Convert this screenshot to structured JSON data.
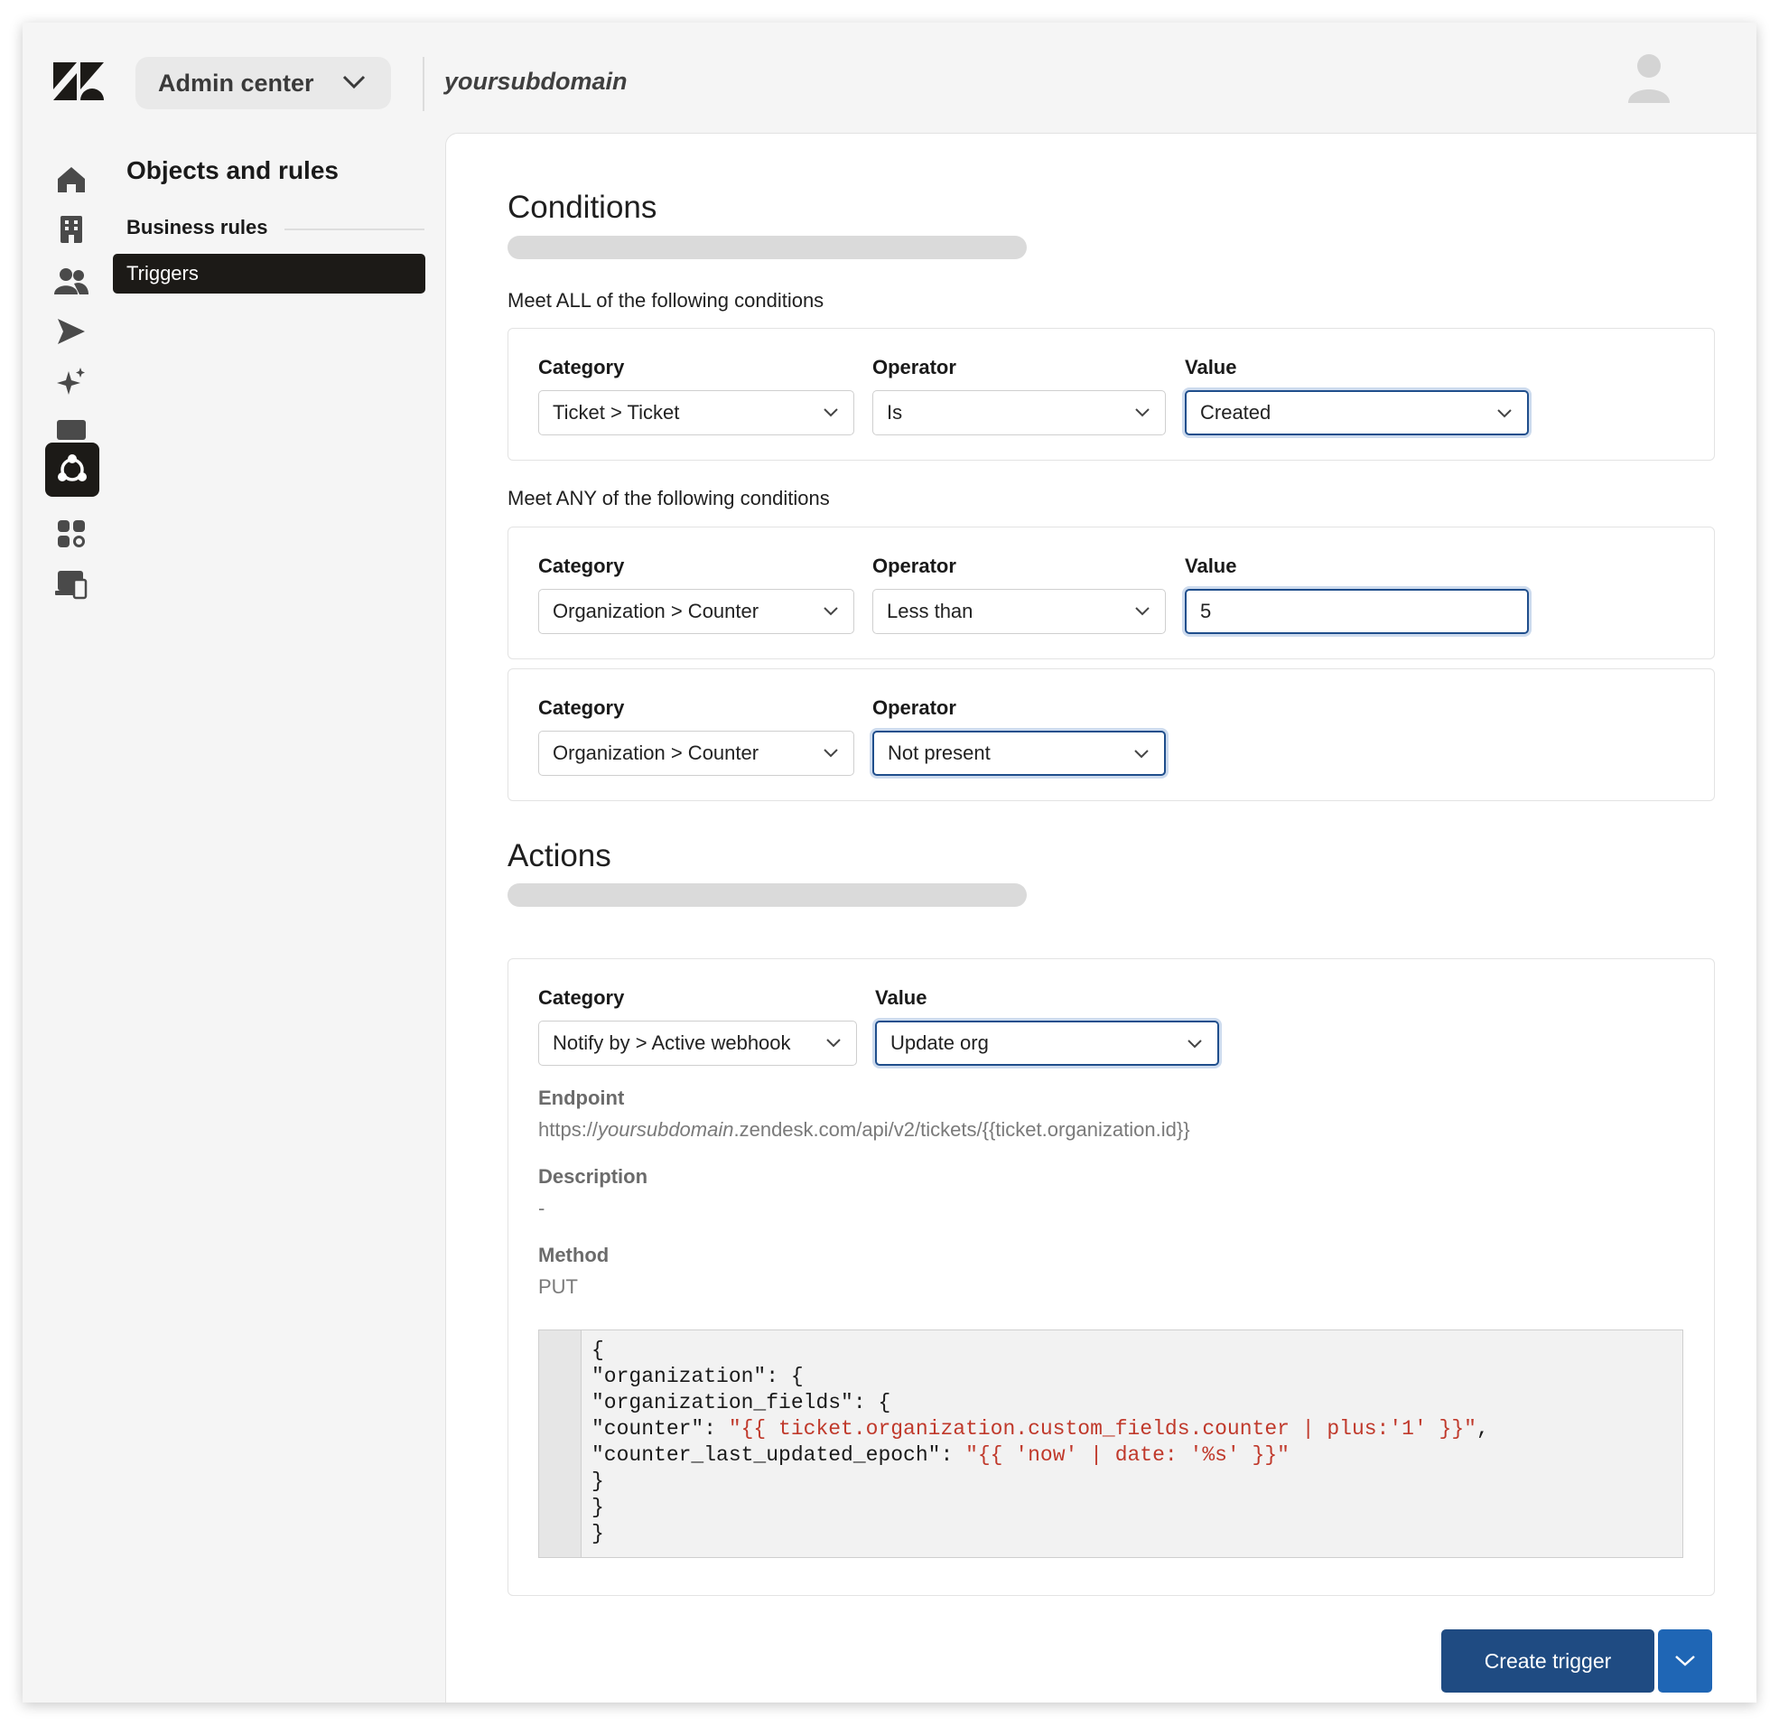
{
  "header": {
    "product_menu_label": "Admin center",
    "subdomain": "yoursubdomain"
  },
  "rail": {
    "icons": [
      "home-icon",
      "building-icon",
      "people-icon",
      "send-icon",
      "sparkle-icon",
      "workspace-icon",
      "objects-rules-icon",
      "apps-icon",
      "devices-icon"
    ],
    "active_icon": "objects-rules-icon"
  },
  "nav": {
    "title": "Objects and rules",
    "section": "Business rules",
    "active_item": "Triggers"
  },
  "conditions": {
    "heading": "Conditions",
    "all_label": "Meet ALL of the following conditions",
    "any_label": "Meet ANY of the following conditions",
    "labels": {
      "category": "Category",
      "operator": "Operator",
      "value": "Value"
    },
    "all": [
      {
        "category": "Ticket > Ticket",
        "operator": "Is",
        "value": "Created"
      }
    ],
    "any": [
      {
        "category": "Organization > Counter",
        "operator": "Less than",
        "value": "5"
      },
      {
        "category": "Organization > Counter",
        "operator": "Not present"
      }
    ]
  },
  "actions": {
    "heading": "Actions",
    "labels": {
      "category": "Category",
      "value": "Value"
    },
    "category": "Notify by > Active webhook",
    "value": "Update org",
    "endpoint_label": "Endpoint",
    "endpoint_prefix": "https://",
    "endpoint_subdomain": "yoursubdomain",
    "endpoint_suffix": ".zendesk.com/api/v2/tickets/{{ticket.organization.id}}",
    "description_label": "Description",
    "description_value": "-",
    "method_label": "Method",
    "method_value": "PUT",
    "body": {
      "open": "{",
      "l1_key": "\"organization\": {",
      "l2_key": "\"organization_fields\": {",
      "counter_key": "\"counter\": ",
      "counter_val": "\"{{ ticket.organization.custom_fields.counter | plus:'1' }}\"",
      "counter_comma": ",",
      "epoch_key": "\"counter_last_updated_epoch\": ",
      "epoch_val": "\"{{ 'now' | date: '%s' }}\"",
      "close1": "}",
      "close2": "}",
      "close3": "}"
    }
  },
  "footer": {
    "primary_button": "Create trigger"
  },
  "colors": {
    "primary": "#1f4b82",
    "split": "#1f66b5",
    "focus_border": "#1f4e8c",
    "code_string": "#c0392b",
    "nav_active_bg": "#1c1a17"
  }
}
